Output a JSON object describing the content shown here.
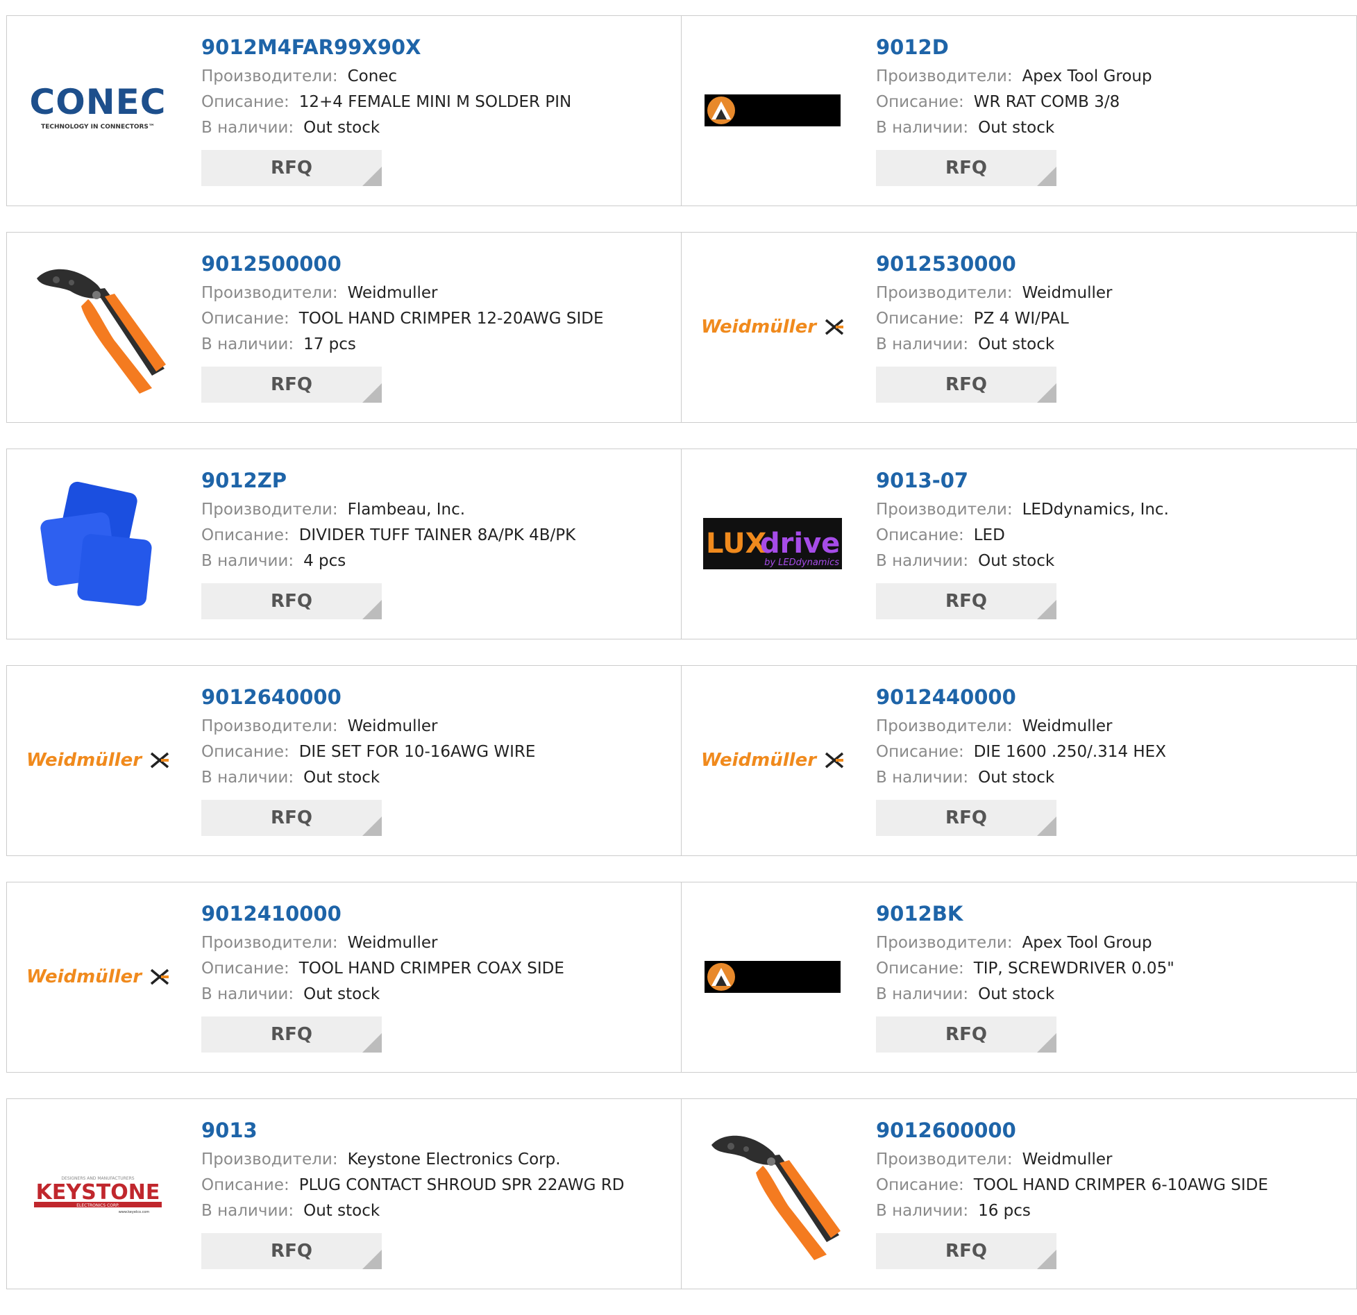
{
  "labels": {
    "manufacturer": "Производители:",
    "description": "Описание:",
    "stock": "В наличии:",
    "rfq": "RFQ"
  },
  "brands": {
    "conec": {
      "name": "CONEC",
      "tagline": "TECHNOLOGY IN CONNECTORS™"
    },
    "weidmuller": {
      "name": "Weidmüller"
    },
    "luxdrive": {
      "name_a": "LUX",
      "name_b": "drive",
      "tagline": "by LEDdynamics"
    },
    "keystone": {
      "name": "KEYSTONE",
      "tagline_top": "DESIGNERS AND MANUFACTURERS",
      "tagline_mid": "ELECTRONICS CORP.",
      "url": "www.keyelco.com"
    }
  },
  "colors": {
    "link": "#1e64a8",
    "weidmuller_orange": "#f08a1d",
    "conec_blue": "#1d4f8c",
    "keystone_red": "#c0272d",
    "lux_purple": "#a64ce8",
    "crimper_orange": "#f47b20"
  },
  "products": [
    {
      "part": "9012M4FAR99X90X",
      "manufacturer": "Conec",
      "description": "12+4 FEMALE MINI M SOLDER PIN",
      "stock": "Out stock",
      "logo": "conec-logo"
    },
    {
      "part": "9012D",
      "manufacturer": "Apex Tool Group",
      "description": "WR RAT COMB 3/8",
      "stock": "Out stock",
      "logo": "apex-logo"
    },
    {
      "part": "9012500000",
      "manufacturer": "Weidmuller",
      "description": "TOOL HAND CRIMPER 12-20AWG SIDE",
      "stock": "17 pcs",
      "logo": "crimper-photo"
    },
    {
      "part": "9012530000",
      "manufacturer": "Weidmuller",
      "description": "PZ 4 WI/PAL",
      "stock": "Out stock",
      "logo": "weidmuller-logo"
    },
    {
      "part": "9012ZP",
      "manufacturer": "Flambeau, Inc.",
      "description": "DIVIDER TUFF TAINER 8A/PK 4B/PK",
      "stock": "4 pcs",
      "logo": "divider-photo"
    },
    {
      "part": "9013-07",
      "manufacturer": "LEDdynamics, Inc.",
      "description": "LED",
      "stock": "Out stock",
      "logo": "luxdrive-logo"
    },
    {
      "part": "9012640000",
      "manufacturer": "Weidmuller",
      "description": "DIE SET FOR 10-16AWG WIRE",
      "stock": "Out stock",
      "logo": "weidmuller-logo"
    },
    {
      "part": "9012440000",
      "manufacturer": "Weidmuller",
      "description": "DIE 1600 .250/.314 HEX",
      "stock": "Out stock",
      "logo": "weidmuller-logo"
    },
    {
      "part": "9012410000",
      "manufacturer": "Weidmuller",
      "description": "TOOL HAND CRIMPER COAX SIDE",
      "stock": "Out stock",
      "logo": "weidmuller-logo"
    },
    {
      "part": "9012BK",
      "manufacturer": "Apex Tool Group",
      "description": "TIP, SCREWDRIVER 0.05\"",
      "stock": "Out stock",
      "logo": "apex-logo"
    },
    {
      "part": "9013",
      "manufacturer": "Keystone Electronics Corp.",
      "description": "PLUG CONTACT SHROUD SPR 22AWG RD",
      "stock": "Out stock",
      "logo": "keystone-logo"
    },
    {
      "part": "9012600000",
      "manufacturer": "Weidmuller",
      "description": "TOOL HAND CRIMPER 6-10AWG SIDE",
      "stock": "16 pcs",
      "logo": "crimper-photo"
    }
  ]
}
